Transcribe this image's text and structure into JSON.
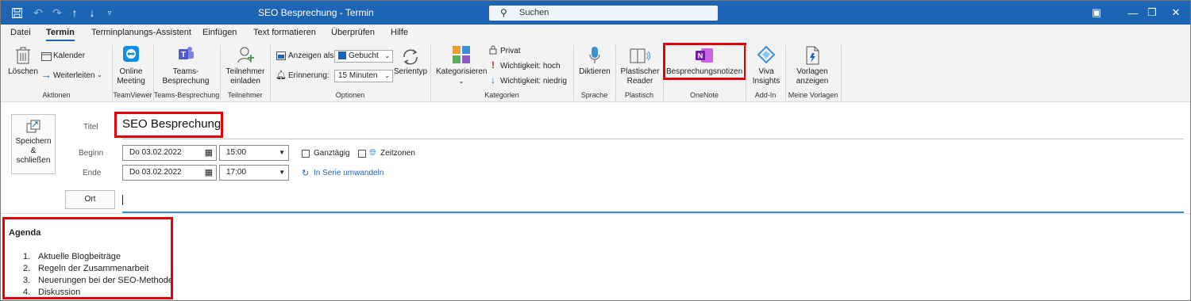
{
  "titlebar": {
    "title": "SEO Besprechung  -  Termin",
    "search_placeholder": "Suchen",
    "accent": "#1e64b4"
  },
  "tabs": [
    "Datei",
    "Termin",
    "Terminplanungs-Assistent",
    "Einfügen",
    "Text formatieren",
    "Überprüfen",
    "Hilfe"
  ],
  "active_tab": "Termin",
  "ribbon": {
    "delete": "Löschen",
    "calendar": "Kalender",
    "forward": "Weiterleiten",
    "online_meeting": [
      "Online",
      "Meeting"
    ],
    "teams_meeting": [
      "Teams-",
      "Besprechung"
    ],
    "invite": [
      "Teilnehmer",
      "einladen"
    ],
    "show_as_label": "Anzeigen als:",
    "show_as_value": "Gebucht",
    "reminder_label": "Erinnerung:",
    "reminder_value": "15 Minuten",
    "series": "Serientyp",
    "categorize": "Kategorisieren",
    "private": "Privat",
    "importance_high": "Wichtigkeit: hoch",
    "importance_low": "Wichtigkeit: niedrig",
    "dictate": "Diktieren",
    "reader": [
      "Plastischer",
      "Reader"
    ],
    "meeting_notes": "Besprechungsnotizen",
    "viva": [
      "Viva",
      "Insights"
    ],
    "templates": [
      "Vorlagen",
      "anzeigen"
    ],
    "groups": {
      "actions": "Aktionen",
      "teamviewer": "TeamViewer",
      "teams": "Teams-Besprechung",
      "participants": "Teilnehmer",
      "options": "Optionen",
      "categories": "Kategorien",
      "speech": "Sprache",
      "immersive": "Plastisch",
      "onenote": "OneNote",
      "addin": "Add-In",
      "templates": "Meine Vorlagen"
    }
  },
  "form": {
    "save_close": [
      "Speichern",
      "&",
      "schließen"
    ],
    "title_label": "Titel",
    "title_value": "SEO Besprechung",
    "start_label": "Beginn",
    "start_date": "Do 03.02.2022",
    "start_time": "15:00",
    "end_label": "Ende",
    "end_date": "Do 03.02.2022",
    "end_time": "17:00",
    "all_day": "Ganztägig",
    "time_zones": "Zeitzonen",
    "make_recurring": "In Serie umwandeln",
    "location_button": "Ort",
    "location_value": ""
  },
  "body": {
    "heading": "Agenda",
    "items": [
      "Aktuelle Blogbeiträge",
      "Regeln der Zusammenarbeit",
      "Neuerungen bei der SEO-Methode",
      "Diskussion"
    ]
  },
  "highlight_color": "#e5000b"
}
